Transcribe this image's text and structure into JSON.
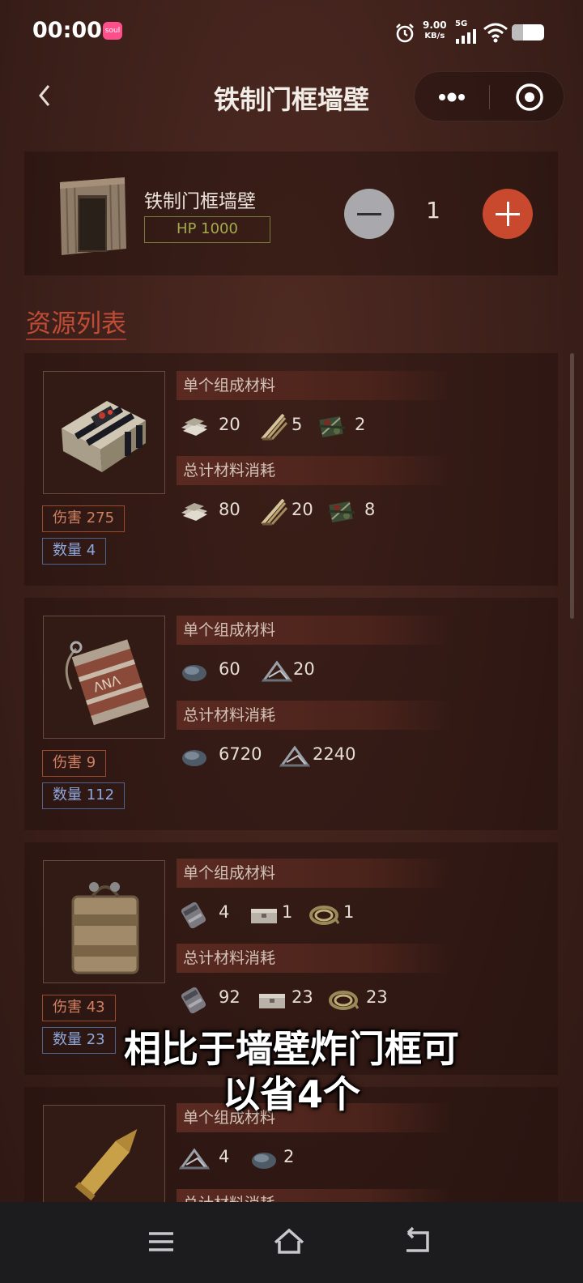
{
  "status_bar": {
    "time": "00:00",
    "app_badge": "soul",
    "net_speed_value": "9.00",
    "net_speed_unit": "KB/s",
    "network_type": "5G"
  },
  "nav": {
    "title": "铁制门框墙壁"
  },
  "item": {
    "name": "铁制门框墙壁",
    "hp": "HP 1000",
    "quantity": "1"
  },
  "section_title": "资源列表",
  "labels": {
    "single": "单个组成材料",
    "total": "总计材料消耗"
  },
  "resources": [
    {
      "damage": "伤害 275",
      "count": "数量 4",
      "thumb_icon": "c4-explosive-icon",
      "single": [
        {
          "icon": "fabric-icon",
          "value": "20"
        },
        {
          "icon": "fuse-icon",
          "value": "5"
        },
        {
          "icon": "tech-trash-icon",
          "value": "2"
        }
      ],
      "total": [
        {
          "icon": "fabric-icon",
          "value": "80"
        },
        {
          "icon": "fuse-icon",
          "value": "20"
        },
        {
          "icon": "tech-trash-icon",
          "value": "8"
        }
      ]
    },
    {
      "damage": "伤害 9",
      "count": "数量 112",
      "thumb_icon": "beancan-grenade-icon",
      "single": [
        {
          "icon": "sulfur-icon",
          "value": "60"
        },
        {
          "icon": "charcoal-icon",
          "value": "20"
        }
      ],
      "total": [
        {
          "icon": "sulfur-icon",
          "value": "6720"
        },
        {
          "icon": "charcoal-icon",
          "value": "2240"
        }
      ]
    },
    {
      "damage": "伤害 43",
      "count": "数量 23",
      "thumb_icon": "satchel-charge-icon",
      "single": [
        {
          "icon": "beancan-icon",
          "value": "4"
        },
        {
          "icon": "small-stash-icon",
          "value": "1"
        },
        {
          "icon": "rope-icon",
          "value": "1"
        }
      ],
      "total": [
        {
          "icon": "beancan-icon",
          "value": "92"
        },
        {
          "icon": "small-stash-icon",
          "value": "23"
        },
        {
          "icon": "rope-icon",
          "value": "23"
        }
      ]
    },
    {
      "thumb_icon": "rifle-ammo-icon",
      "single": [
        {
          "icon": "charcoal-icon",
          "value": "4"
        },
        {
          "icon": "sulfur-icon",
          "value": "2"
        }
      ]
    }
  ],
  "overlay_caption": {
    "line1": "相比于墙壁炸门框可",
    "line2": "以省4个"
  },
  "colors": {
    "accent": "#c14c36",
    "hp_border": "#7a7a39",
    "damage": "#9c4a2c",
    "count": "#4e648f"
  }
}
